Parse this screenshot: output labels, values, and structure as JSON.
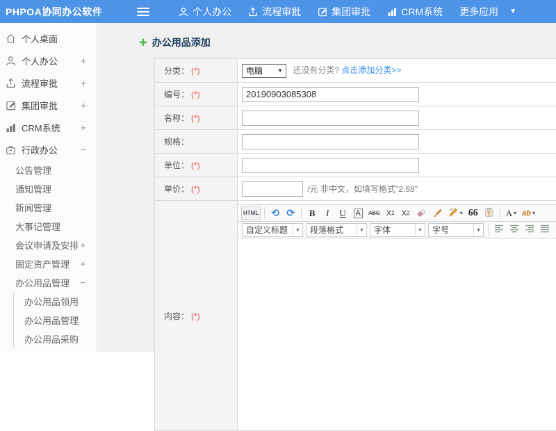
{
  "topbar": {
    "brand": "PHPOA协同办公软件",
    "nav": [
      {
        "label": "个人办公"
      },
      {
        "label": "流程审批"
      },
      {
        "label": "集团审批"
      },
      {
        "label": "CRM系统"
      },
      {
        "label": "更多应用"
      }
    ]
  },
  "sidebar": {
    "items": [
      {
        "label": "个人桌面",
        "toggle": ""
      },
      {
        "label": "个人办公",
        "toggle": "+"
      },
      {
        "label": "流程审批",
        "toggle": "+"
      },
      {
        "label": "集团审批",
        "toggle": "+"
      },
      {
        "label": "CRM系统",
        "toggle": "+"
      },
      {
        "label": "行政办公",
        "toggle": "−"
      }
    ],
    "sub_items": [
      {
        "label": "公告管理",
        "toggle": ""
      },
      {
        "label": "通知管理",
        "toggle": ""
      },
      {
        "label": "新闻管理",
        "toggle": ""
      },
      {
        "label": "大事记管理",
        "toggle": ""
      },
      {
        "label": "会议申请及安排",
        "toggle": "+"
      },
      {
        "label": "固定资产管理",
        "toggle": "+"
      },
      {
        "label": "办公用品管理",
        "toggle": "−"
      }
    ],
    "leaf_items": [
      {
        "label": "办公用品领用"
      },
      {
        "label": "办公用品管理"
      },
      {
        "label": "办公用品采购"
      }
    ]
  },
  "main": {
    "title": "办公用品添加",
    "form": {
      "category": {
        "label": "分类：",
        "required": "(*)",
        "selected": "电脑",
        "note": "还没有分类?",
        "link": "点击添加分类>>"
      },
      "code": {
        "label": "编号：",
        "required": "(*)",
        "value": "20190903085308"
      },
      "name": {
        "label": "名称：",
        "required": "(*)",
        "value": ""
      },
      "spec": {
        "label": "规格：",
        "required": "",
        "value": ""
      },
      "unit": {
        "label": "单位：",
        "required": "(*)",
        "value": ""
      },
      "price": {
        "label": "单价：",
        "required": "(*)",
        "value": "",
        "hint": "/元 非中文，如填写格式\"2.68\""
      },
      "content": {
        "label": "内容：",
        "required": "(*)"
      }
    }
  },
  "editor": {
    "toolbar1": {
      "html": "HTML",
      "bold": "B",
      "italic": "I",
      "underline": "U",
      "border_a": "A",
      "strike": "ABC",
      "sup_base": "X",
      "sup_exp": "2",
      "sub_base": "X",
      "sub_idx": "2",
      "quote": "66",
      "fontcolor": "A",
      "highlight": "ab"
    },
    "toolbar2": {
      "selects": [
        {
          "label": "自定义标题"
        },
        {
          "label": "段落格式"
        },
        {
          "label": "字体"
        },
        {
          "label": "字号"
        }
      ]
    }
  },
  "icons": {
    "caret_down": "▼",
    "caret_small": "▾",
    "plus_green": "✚",
    "undo": "⟲",
    "redo": "⟳"
  },
  "colors": {
    "topbar_blue": "#4d93e6",
    "link_blue": "#2f8ded",
    "required_red": "#f05050",
    "title_navy": "#1d3d5f",
    "plus_green": "#5cb85c"
  }
}
